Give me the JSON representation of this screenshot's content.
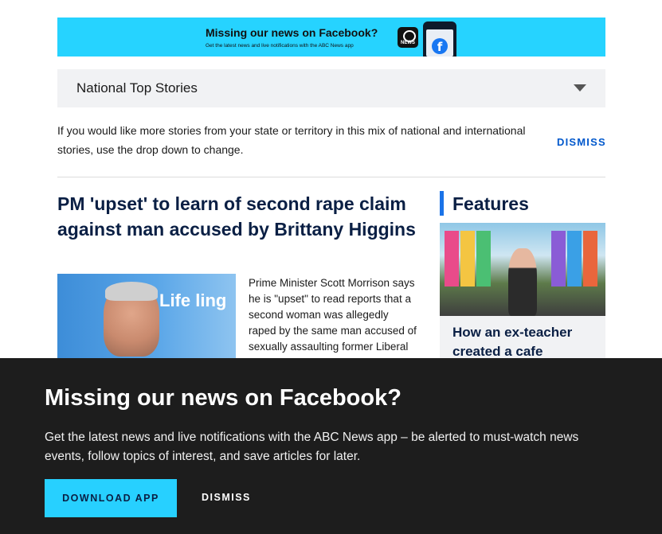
{
  "promo_banner": {
    "title": "Missing our news on Facebook?",
    "subtitle": "Get the latest news and live notifications with the ABC News app",
    "logo_text": "NEWS",
    "fb_glyph": "f",
    "color": "#26d3ff"
  },
  "region_select": {
    "value": "National Top Stories",
    "icon": "chevron-down-icon"
  },
  "region_notice": {
    "text": "If you would like more stories from your state or territory in this mix of national and international stories, use the drop down to change.",
    "dismiss_label": "DISMISS",
    "link_color": "#0058cc"
  },
  "top_story": {
    "headline": "PM 'upset' to learn of second rape claim against man accused by Brittany Higgins",
    "image_text": "Life ling",
    "summary": "Prime Minister Scott Morrison says he is \"upset\" to read reports that a second woman was allegedly raped by the same man accused of sexually assaulting former Liberal"
  },
  "features": {
    "title": "Features",
    "accent_color": "#1a73e8",
    "item": {
      "headline": "How an ex-teacher created a cafe"
    }
  },
  "facebook_overlay": {
    "title": "Missing our news on Facebook?",
    "body": "Get the latest news and live notifications with the ABC News app – be alerted to must-watch news events, follow topics of interest, and save articles for later.",
    "download_label": "DOWNLOAD APP",
    "dismiss_label": "DISMISS",
    "button_color": "#27d0ff",
    "background": "#1d1d1d"
  }
}
